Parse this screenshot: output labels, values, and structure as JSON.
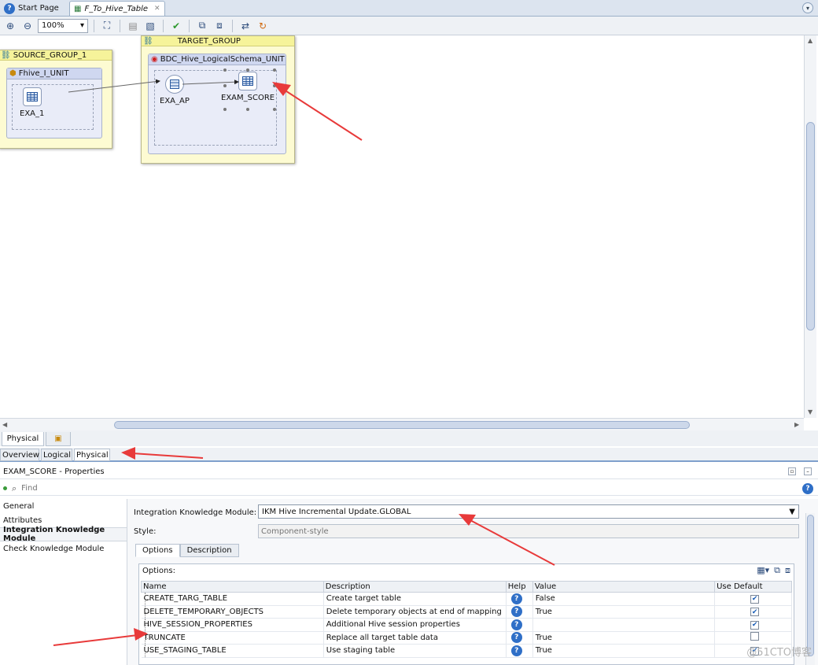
{
  "editor_tabs": [
    {
      "label": "Start Page"
    },
    {
      "label": "F_To_Hive_Table"
    }
  ],
  "toolbar": {
    "zoom": "100%"
  },
  "canvas": {
    "source_group": {
      "title": "SOURCE_GROUP_1",
      "unit_title": "Fhive_I_UNIT",
      "node": "EXA_1"
    },
    "target_group": {
      "title": "TARGET_GROUP",
      "unit_title": "BDC_Hive_LogicalSchema_UNIT",
      "node_ap": "EXA_AP",
      "node_score": "EXAM_SCORE"
    }
  },
  "diagram_tabs": {
    "physical": "Physical"
  },
  "view_tabs": [
    "Overview",
    "Logical",
    "Physical"
  ],
  "properties": {
    "title": "EXAM_SCORE - Properties",
    "find_placeholder": "Find",
    "nav": [
      "General",
      "Attributes",
      "Integration Knowledge Module",
      "Check Knowledge Module"
    ],
    "ikm_label": "Integration Knowledge Module:",
    "ikm_value": "IKM Hive Incremental Update.GLOBAL",
    "style_label": "Style:",
    "style_placeholder": "Component-style",
    "sub_tabs": [
      "Options",
      "Description"
    ],
    "options_label": "Options:",
    "columns": [
      "Name",
      "Description",
      "Help",
      "Value",
      "Use Default"
    ],
    "rows": [
      {
        "name": "CREATE_TARG_TABLE",
        "description": "Create target table",
        "value": "False",
        "use_default": true
      },
      {
        "name": "DELETE_TEMPORARY_OBJECTS",
        "description": "Delete temporary objects at end of mapping",
        "value": "True",
        "use_default": true
      },
      {
        "name": "HIVE_SESSION_PROPERTIES",
        "description": "Additional Hive session properties",
        "value": "",
        "use_default": true
      },
      {
        "name": "TRUNCATE",
        "description": "Replace all target table data",
        "value": "True",
        "use_default": false
      },
      {
        "name": "USE_STAGING_TABLE",
        "description": "Use staging table",
        "value": "True",
        "use_default": true
      }
    ]
  },
  "watermark": "@51CTO博客",
  "colors": {
    "annotation_arrow": "#e83a3a",
    "accent": "#2f6fc7"
  }
}
